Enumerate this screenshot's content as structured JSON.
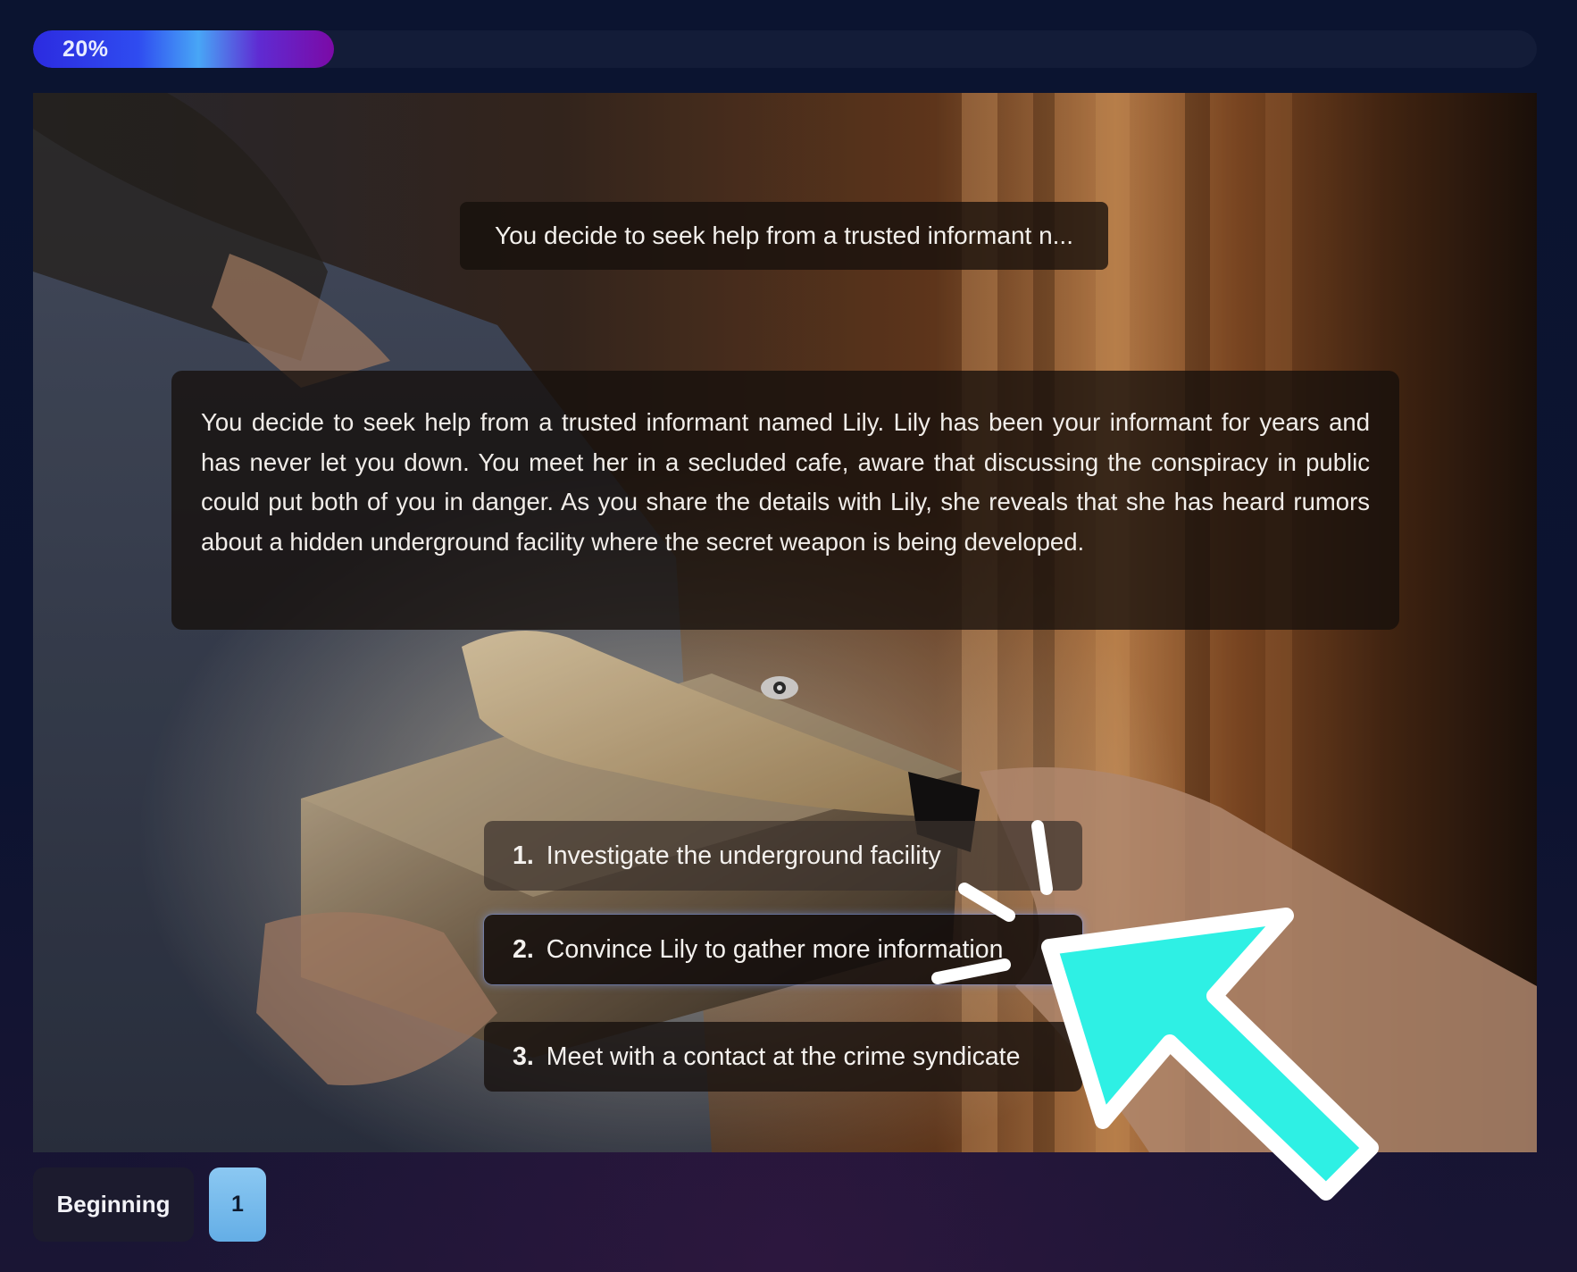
{
  "progress": {
    "label": "20%",
    "value": 0.2
  },
  "scene": {
    "summary": "You decide to seek help from a trusted informant n...",
    "narrative": "You decide to seek help from a trusted informant named Lily. Lily has been your informant for years and has never let you down. You meet her in a secluded cafe, aware that discussing the conspiracy in public could put both of you in danger. As you share the details with Lily, she reveals that she has heard rumors about a hidden underground facility where the secret weapon is being developed.",
    "choices": [
      {
        "number": "1.",
        "label": "Investigate the underground facility"
      },
      {
        "number": "2.",
        "label": "Convince Lily to gather more information"
      },
      {
        "number": "3.",
        "label": "Meet with a contact at the crime syndicate"
      }
    ]
  },
  "history": {
    "beginning_label": "Beginning",
    "step_label": "1"
  },
  "colors": {
    "background": "#0a1126",
    "cursor_fill": "#2ef0e4",
    "step_chip": "#6cb4ea"
  },
  "icons": {
    "reveal": "eye-icon",
    "pointer": "cursor-arrow-icon"
  }
}
